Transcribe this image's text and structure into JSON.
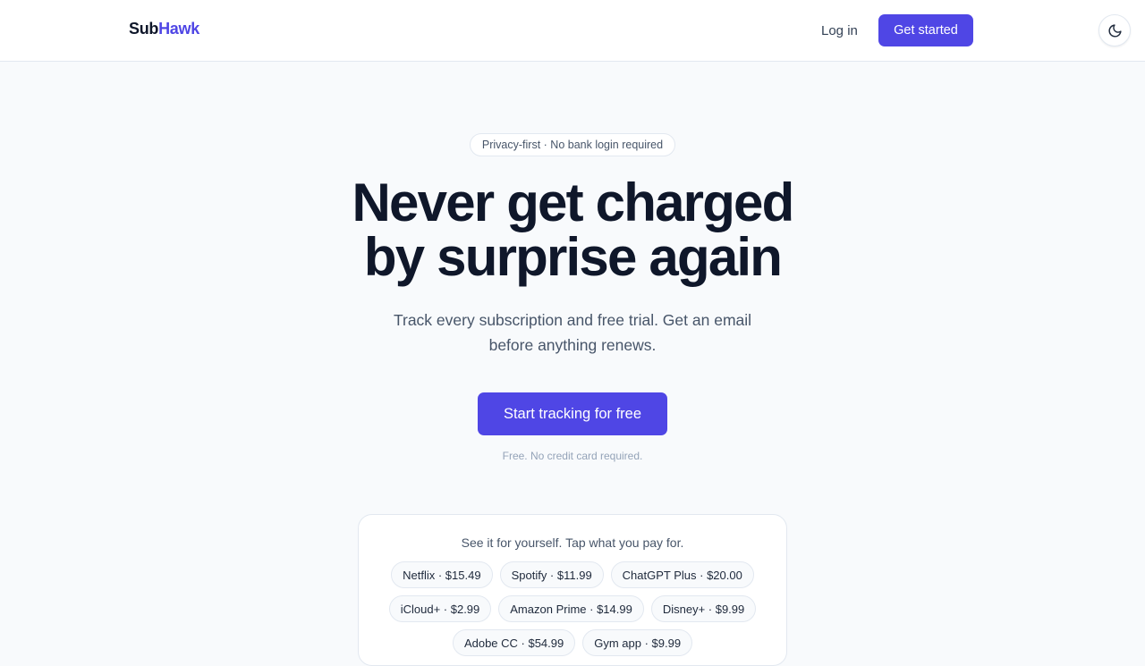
{
  "header": {
    "logo_part1": "Sub",
    "logo_part2": "Hawk",
    "login_label": "Log in",
    "get_started_label": "Get started",
    "theme_icon": "moon-icon"
  },
  "hero": {
    "badge": "Privacy-first · No bank login required",
    "headline_line1": "Never get charged",
    "headline_line2": "by surprise again",
    "subhead_line1": "Track every subscription and free trial. Get an email",
    "subhead_line2": "before anything renews.",
    "cta_label": "Start tracking for free",
    "fine_print": "Free. No credit card required."
  },
  "picker": {
    "title": "See it for yourself. Tap what you pay for.",
    "chips": [
      "Netflix · $15.49",
      "Spotify · $11.99",
      "ChatGPT Plus · $20.00",
      "iCloud+ · $2.99",
      "Amazon Prime · $14.99",
      "Disney+ · $9.99",
      "Adobe CC · $54.99",
      "Gym app · $9.99"
    ]
  },
  "colors": {
    "accent": "#4f46e5",
    "text": "#0f172a",
    "muted": "#475569",
    "background": "#f8fafc"
  }
}
